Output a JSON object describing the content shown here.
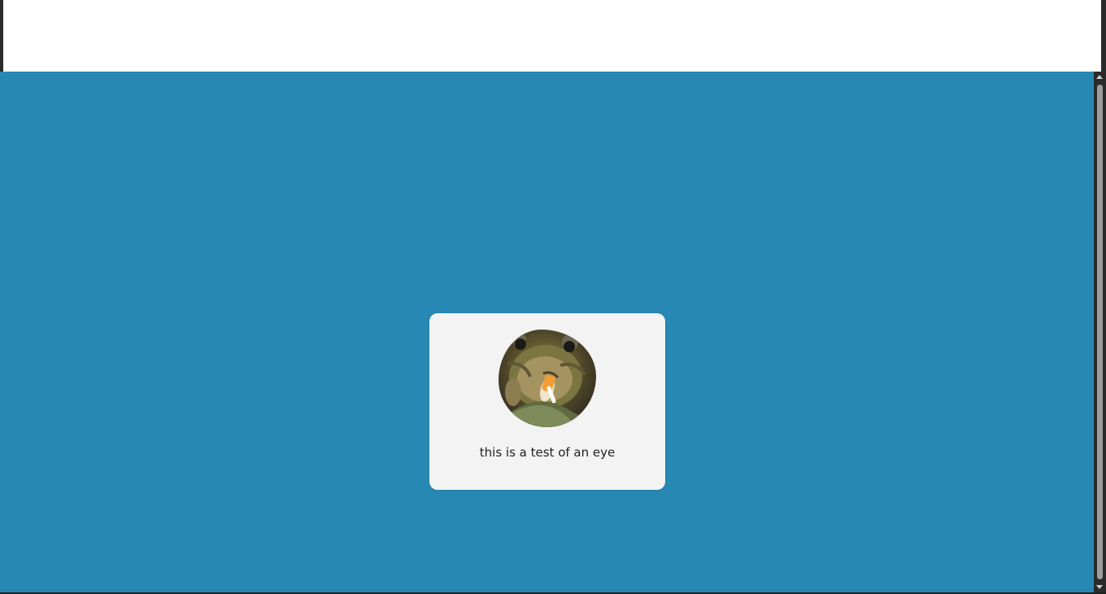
{
  "colors": {
    "page_background": "#2789b3",
    "card_background": "#f3f3f3",
    "scrollbar_track": "#2b2b2b",
    "scrollbar_thumb": "#9e9e9e"
  },
  "card": {
    "caption": "this is a test of an eye"
  },
  "icons": {
    "scroll_up": "arrow-up-icon",
    "scroll_down": "arrow-down-icon"
  }
}
